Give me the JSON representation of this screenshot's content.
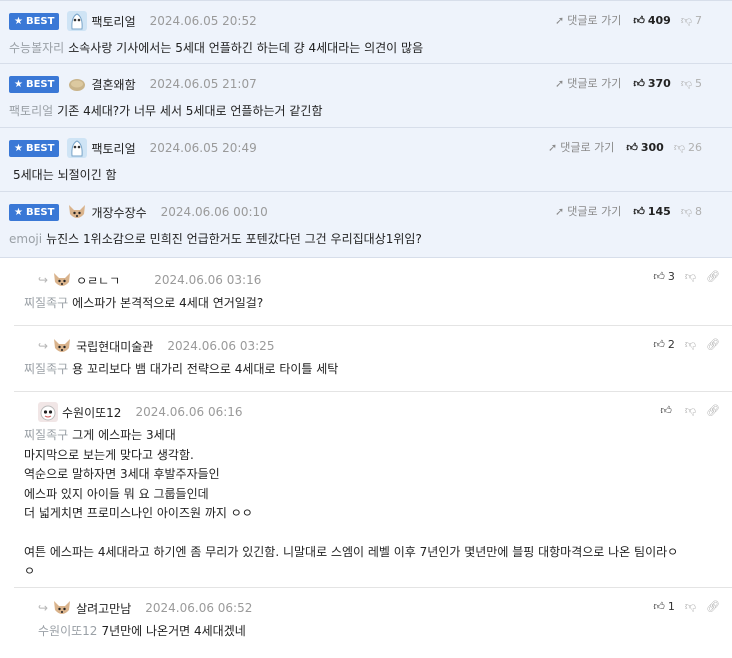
{
  "best_label": "BEST",
  "reply_label": "댓글로 가기",
  "best_comments": [
    {
      "nick": "팩토리얼",
      "date": "2024.06.05 20:52",
      "up": "409",
      "down": "7",
      "ref": "수능볼자리",
      "text": "소속사랑 기사에서는 5세대 언플하긴 하는데 걍 4세대라는 의견이 많음",
      "avatar": "ghost"
    },
    {
      "nick": "결혼왜함",
      "date": "2024.06.05 21:07",
      "up": "370",
      "down": "5",
      "ref": "팩토리얼",
      "text": "기존 4세대?가 너무 세서 5세대로 언플하는거 같긴함",
      "avatar": "potato"
    },
    {
      "nick": "팩토리얼",
      "date": "2024.06.05 20:49",
      "up": "300",
      "down": "26",
      "ref": "",
      "text": "5세대는 뇌절이긴 함",
      "avatar": "ghost"
    },
    {
      "nick": "개장수장수",
      "date": "2024.06.06 00:10",
      "up": "145",
      "down": "8",
      "ref": "emoji",
      "text": "뉴진스 1위소감으로 민희진 언급한거도 포텐갔다던 그건 우리집대상1위임?",
      "avatar": "dog"
    }
  ],
  "replies": [
    {
      "nick": "ㅇㄹㄴㄱ",
      "date": "2024.06.06 03:16",
      "up": "3",
      "ref": "찌질족구",
      "lines": [
        "에스파가 본격적으로 4세대 연거일걸?"
      ],
      "avatar": "dog"
    },
    {
      "nick": "국립현대미술관",
      "date": "2024.06.06 03:25",
      "up": "2",
      "ref": "찌질족구",
      "lines": [
        "용 꼬리보다 뱀 대가리 전략으로 4세대로 타이틀 세탁"
      ],
      "avatar": "dog"
    },
    {
      "nick": "수원이또12",
      "date": "2024.06.06 06:16",
      "up": "",
      "ref": "찌질족구",
      "lines": [
        "그게 에스파는 3세대",
        "마지막으로 보는게 맞다고 생각함.",
        "역순으로 말하자면 3세대 후발주자들인",
        "에스파 있지 아이들 뭐 요 그룹들인데",
        "더 넓게치면 프로미스나인 아이즈원 까지 ㅇㅇ",
        "",
        "여튼 에스파는 4세대라고 하기엔 좀 무리가 있긴함. 니말대로 스엠이 레벨 이후 7년인가 몇년만에 블핑 대항마격으로 나온 팀이라ㅇ",
        "ㅇ"
      ],
      "avatar": "puppy"
    },
    {
      "nick": "살려고만남",
      "date": "2024.06.06 06:52",
      "up": "1",
      "ref": "수원이또12",
      "lines": [
        "7년만에 나온거면 4세대겠네"
      ],
      "avatar": "dog"
    }
  ],
  "colors": {
    "badge": "#3a78d6",
    "best_bg": "#eef3fb"
  }
}
